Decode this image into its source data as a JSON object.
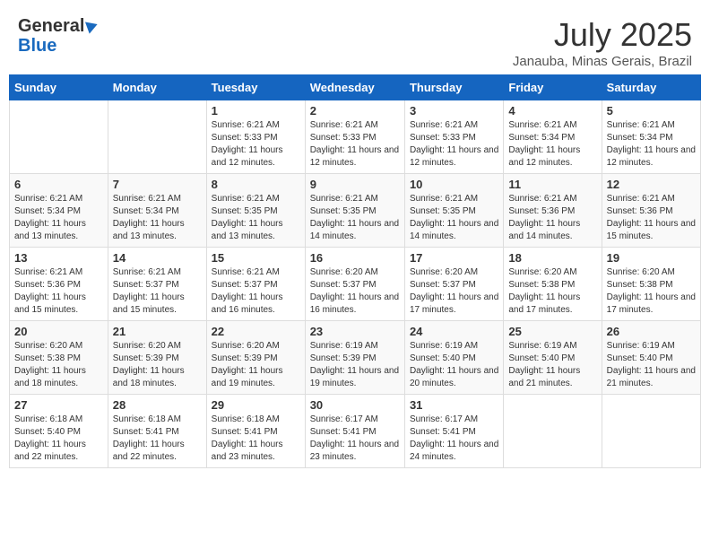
{
  "header": {
    "logo_general": "General",
    "logo_blue": "Blue",
    "month": "July 2025",
    "location": "Janauba, Minas Gerais, Brazil"
  },
  "weekdays": [
    "Sunday",
    "Monday",
    "Tuesday",
    "Wednesday",
    "Thursday",
    "Friday",
    "Saturday"
  ],
  "weeks": [
    [
      {
        "day": "",
        "info": ""
      },
      {
        "day": "",
        "info": ""
      },
      {
        "day": "1",
        "info": "Sunrise: 6:21 AM\nSunset: 5:33 PM\nDaylight: 11 hours and 12 minutes."
      },
      {
        "day": "2",
        "info": "Sunrise: 6:21 AM\nSunset: 5:33 PM\nDaylight: 11 hours and 12 minutes."
      },
      {
        "day": "3",
        "info": "Sunrise: 6:21 AM\nSunset: 5:33 PM\nDaylight: 11 hours and 12 minutes."
      },
      {
        "day": "4",
        "info": "Sunrise: 6:21 AM\nSunset: 5:34 PM\nDaylight: 11 hours and 12 minutes."
      },
      {
        "day": "5",
        "info": "Sunrise: 6:21 AM\nSunset: 5:34 PM\nDaylight: 11 hours and 12 minutes."
      }
    ],
    [
      {
        "day": "6",
        "info": "Sunrise: 6:21 AM\nSunset: 5:34 PM\nDaylight: 11 hours and 13 minutes."
      },
      {
        "day": "7",
        "info": "Sunrise: 6:21 AM\nSunset: 5:34 PM\nDaylight: 11 hours and 13 minutes."
      },
      {
        "day": "8",
        "info": "Sunrise: 6:21 AM\nSunset: 5:35 PM\nDaylight: 11 hours and 13 minutes."
      },
      {
        "day": "9",
        "info": "Sunrise: 6:21 AM\nSunset: 5:35 PM\nDaylight: 11 hours and 14 minutes."
      },
      {
        "day": "10",
        "info": "Sunrise: 6:21 AM\nSunset: 5:35 PM\nDaylight: 11 hours and 14 minutes."
      },
      {
        "day": "11",
        "info": "Sunrise: 6:21 AM\nSunset: 5:36 PM\nDaylight: 11 hours and 14 minutes."
      },
      {
        "day": "12",
        "info": "Sunrise: 6:21 AM\nSunset: 5:36 PM\nDaylight: 11 hours and 15 minutes."
      }
    ],
    [
      {
        "day": "13",
        "info": "Sunrise: 6:21 AM\nSunset: 5:36 PM\nDaylight: 11 hours and 15 minutes."
      },
      {
        "day": "14",
        "info": "Sunrise: 6:21 AM\nSunset: 5:37 PM\nDaylight: 11 hours and 15 minutes."
      },
      {
        "day": "15",
        "info": "Sunrise: 6:21 AM\nSunset: 5:37 PM\nDaylight: 11 hours and 16 minutes."
      },
      {
        "day": "16",
        "info": "Sunrise: 6:20 AM\nSunset: 5:37 PM\nDaylight: 11 hours and 16 minutes."
      },
      {
        "day": "17",
        "info": "Sunrise: 6:20 AM\nSunset: 5:37 PM\nDaylight: 11 hours and 17 minutes."
      },
      {
        "day": "18",
        "info": "Sunrise: 6:20 AM\nSunset: 5:38 PM\nDaylight: 11 hours and 17 minutes."
      },
      {
        "day": "19",
        "info": "Sunrise: 6:20 AM\nSunset: 5:38 PM\nDaylight: 11 hours and 17 minutes."
      }
    ],
    [
      {
        "day": "20",
        "info": "Sunrise: 6:20 AM\nSunset: 5:38 PM\nDaylight: 11 hours and 18 minutes."
      },
      {
        "day": "21",
        "info": "Sunrise: 6:20 AM\nSunset: 5:39 PM\nDaylight: 11 hours and 18 minutes."
      },
      {
        "day": "22",
        "info": "Sunrise: 6:20 AM\nSunset: 5:39 PM\nDaylight: 11 hours and 19 minutes."
      },
      {
        "day": "23",
        "info": "Sunrise: 6:19 AM\nSunset: 5:39 PM\nDaylight: 11 hours and 19 minutes."
      },
      {
        "day": "24",
        "info": "Sunrise: 6:19 AM\nSunset: 5:40 PM\nDaylight: 11 hours and 20 minutes."
      },
      {
        "day": "25",
        "info": "Sunrise: 6:19 AM\nSunset: 5:40 PM\nDaylight: 11 hours and 21 minutes."
      },
      {
        "day": "26",
        "info": "Sunrise: 6:19 AM\nSunset: 5:40 PM\nDaylight: 11 hours and 21 minutes."
      }
    ],
    [
      {
        "day": "27",
        "info": "Sunrise: 6:18 AM\nSunset: 5:40 PM\nDaylight: 11 hours and 22 minutes."
      },
      {
        "day": "28",
        "info": "Sunrise: 6:18 AM\nSunset: 5:41 PM\nDaylight: 11 hours and 22 minutes."
      },
      {
        "day": "29",
        "info": "Sunrise: 6:18 AM\nSunset: 5:41 PM\nDaylight: 11 hours and 23 minutes."
      },
      {
        "day": "30",
        "info": "Sunrise: 6:17 AM\nSunset: 5:41 PM\nDaylight: 11 hours and 23 minutes."
      },
      {
        "day": "31",
        "info": "Sunrise: 6:17 AM\nSunset: 5:41 PM\nDaylight: 11 hours and 24 minutes."
      },
      {
        "day": "",
        "info": ""
      },
      {
        "day": "",
        "info": ""
      }
    ]
  ]
}
